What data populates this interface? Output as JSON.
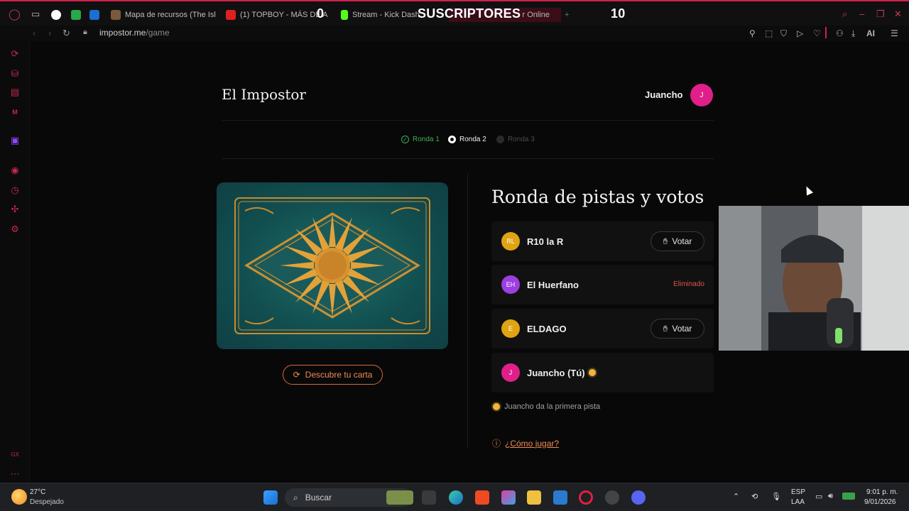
{
  "browser": {
    "tabs": [
      {
        "label": "Mapa de recursos (The Isl"
      },
      {
        "label": "(1) TOPBOY - MÁS DE A"
      },
      {
        "label": "Stream - Kick Dash"
      },
      {
        "label": "r Online"
      }
    ],
    "overlay": {
      "left_count": "0",
      "title": "SUSCRIPTORES",
      "right_count": "10"
    },
    "new_tab": "+",
    "url_host": "impostor.me",
    "url_path": "/game",
    "ai_label": "AI"
  },
  "header": {
    "site_title": "El Impostor",
    "user_name": "Juancho",
    "user_initial": "J"
  },
  "rounds": [
    {
      "label": "Ronda 1",
      "state": "done"
    },
    {
      "label": "Ronda 2",
      "state": "current"
    },
    {
      "label": "Ronda 3",
      "state": "pending"
    }
  ],
  "card": {
    "reveal_button": "Descubre tu carta"
  },
  "panel": {
    "title": "Ronda de pistas y votos",
    "players": [
      {
        "initials": "RL",
        "name": "R10 la R",
        "action": "Votar",
        "color": "#e0a412"
      },
      {
        "initials": "EH",
        "name": "El Huerfano",
        "status": "Eliminado",
        "color": "#9b3fe0"
      },
      {
        "initials": "E",
        "name": "ELDAGO",
        "action": "Votar",
        "color": "#e0a412"
      },
      {
        "initials": "J",
        "name": "Juancho (Tú)",
        "color": "#e01f8a"
      }
    ],
    "hint": "Juancho da la primera pista",
    "how_to_play": "¿Cómo jugar?"
  },
  "taskbar": {
    "weather_temp": "27°C",
    "weather_desc": "Despejado",
    "search_placeholder": "Buscar",
    "lang": "ESP",
    "lang_sub": "LAA",
    "time": "9:01 p. m.",
    "date": "9/01/2026"
  },
  "colors": {
    "accent": "#d2204a",
    "orange": "#f08a55",
    "done_green": "#3fae5a"
  }
}
